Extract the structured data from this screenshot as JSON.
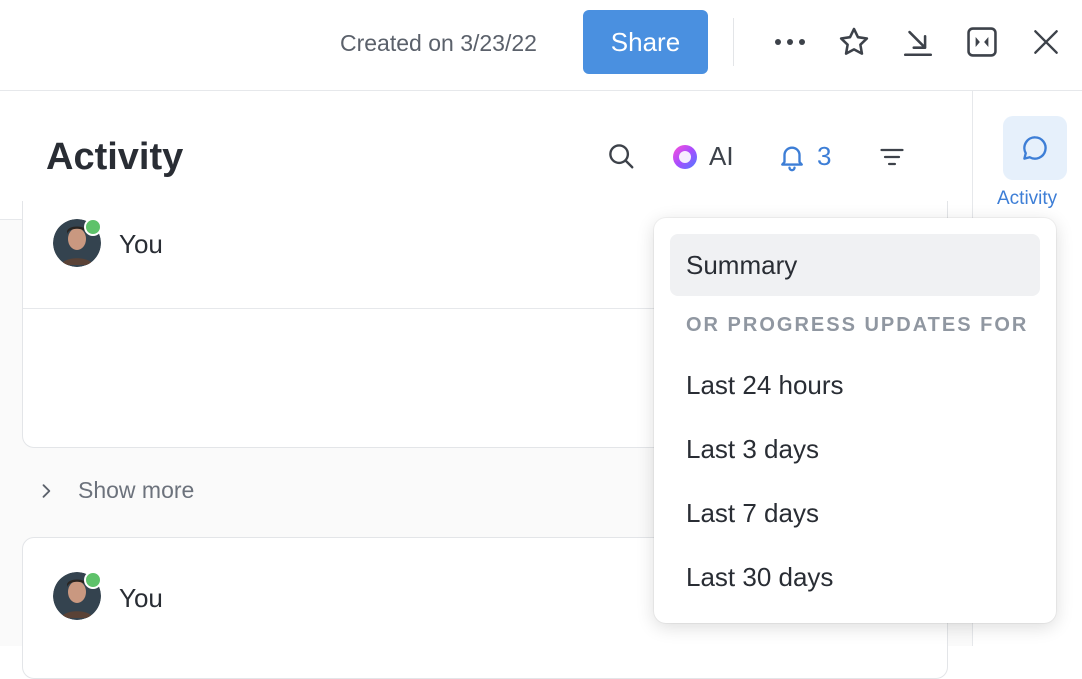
{
  "topbar": {
    "created_text": "Created on 3/23/22",
    "share_label": "Share",
    "icons": [
      "more-icon",
      "star-icon",
      "download-icon",
      "collapse-panel-icon",
      "close-icon"
    ]
  },
  "header": {
    "title": "Activity",
    "ai_label": "AI",
    "notification_count": "3"
  },
  "feed": {
    "items": [
      {
        "user": "You"
      },
      {
        "user": "You"
      }
    ],
    "show_more_label": "Show more"
  },
  "rail": {
    "activity_label": "Activity"
  },
  "filter_menu": {
    "items": [
      {
        "label": "Summary"
      }
    ],
    "section_label": "OR PROGRESS UPDATES FOR",
    "options": [
      {
        "label": "Last 24 hours"
      },
      {
        "label": "Last 3 days"
      },
      {
        "label": "Last 7 days"
      },
      {
        "label": "Last 30 days"
      }
    ]
  },
  "colors": {
    "accent": "#4a90e0",
    "link": "#3d7ed6",
    "online": "#5ec26a"
  }
}
